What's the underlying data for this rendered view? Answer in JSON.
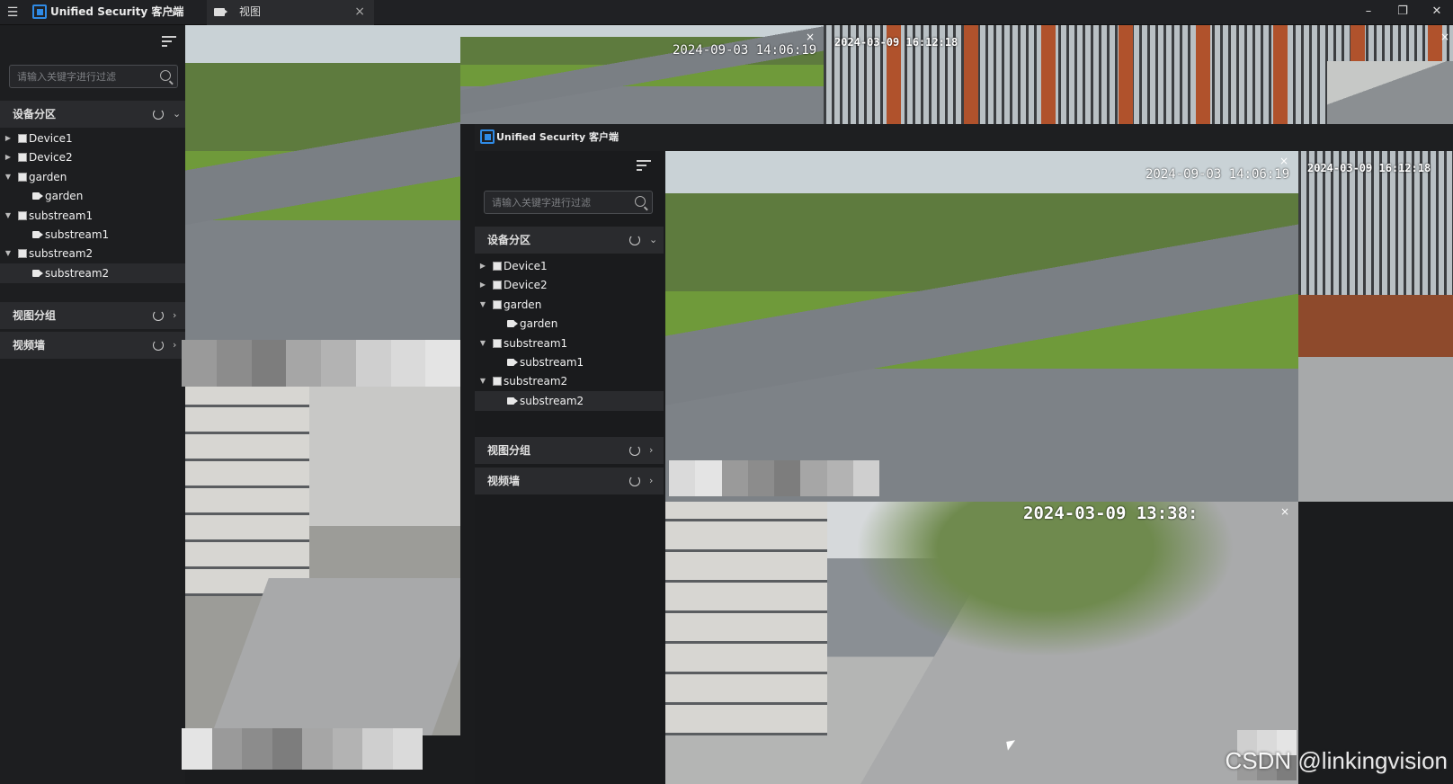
{
  "app": {
    "title": "Unified Security 客户端",
    "tab_label": "视图",
    "tab_close": "×",
    "win_min": "–",
    "win_restore": "❐",
    "win_close": "✕"
  },
  "sidebar": {
    "search_placeholder": "请输入关键字进行过滤",
    "sections": {
      "device_zone": "设备分区",
      "view_group": "视图分组",
      "video_wall": "视频墙"
    },
    "tree": [
      {
        "label": "Device1",
        "kind": "device",
        "level": 0,
        "expanded": false
      },
      {
        "label": "Device2",
        "kind": "device",
        "level": 0,
        "expanded": false
      },
      {
        "label": "garden",
        "kind": "device",
        "level": 0,
        "expanded": true
      },
      {
        "label": "garden",
        "kind": "camera",
        "level": 1
      },
      {
        "label": "substream1",
        "kind": "device",
        "level": 0,
        "expanded": true
      },
      {
        "label": "substream1",
        "kind": "camera",
        "level": 1
      },
      {
        "label": "substream2",
        "kind": "device",
        "level": 0,
        "expanded": true
      },
      {
        "label": "substream2",
        "kind": "camera",
        "level": 1
      }
    ]
  },
  "inner_window": {
    "title": "Unified Security 客户端",
    "search_placeholder": "请输入关键字进行过滤",
    "sections": {
      "device_zone": "设备分区",
      "view_group": "视图分组",
      "video_wall": "视频墙"
    },
    "tree": [
      {
        "label": "Device1",
        "kind": "device",
        "level": 0,
        "expanded": false
      },
      {
        "label": "Device2",
        "kind": "device",
        "level": 0,
        "expanded": false
      },
      {
        "label": "garden",
        "kind": "device",
        "level": 0,
        "expanded": true
      },
      {
        "label": "garden",
        "kind": "camera",
        "level": 1
      },
      {
        "label": "substream1",
        "kind": "device",
        "level": 0,
        "expanded": true
      },
      {
        "label": "substream1",
        "kind": "camera",
        "level": 1
      },
      {
        "label": "substream2",
        "kind": "device",
        "level": 0,
        "expanded": true
      },
      {
        "label": "substream2",
        "kind": "camera",
        "level": 1
      }
    ]
  },
  "video": {
    "outer_park_timestamp": "2024-09-03 14:06:19",
    "outer_fence_timestamp": "2024-03-09 16:12:18",
    "inner_park_timestamp": "2024-09-03 14:06:19",
    "inner_fence_timestamp": "2024-03-09 16:12:18",
    "inner_street_timestamp": "2024-03-09 13:38:",
    "close_glyph": "×"
  },
  "watermark": "CSDN @linkingvision"
}
